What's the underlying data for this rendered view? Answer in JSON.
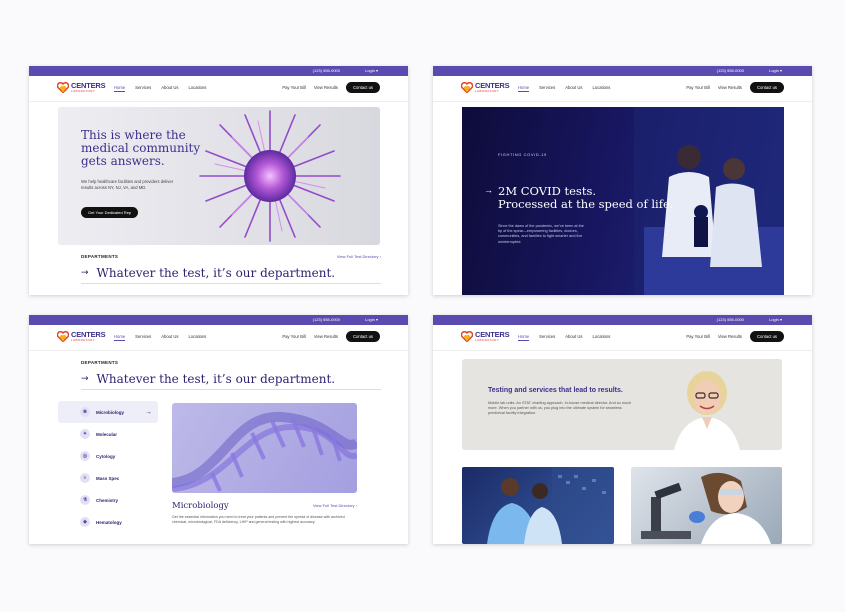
{
  "brand": {
    "name": "CENTERS",
    "sub": "LABORATORY"
  },
  "topbar": {
    "phone": "(123) 555-0000",
    "login": "Login ▾"
  },
  "nav": {
    "items": [
      "Home",
      "Services",
      "About Us",
      "Locations"
    ],
    "pay": "Pay Your Bill",
    "results": "View Results",
    "contact": "Contact us"
  },
  "screen1": {
    "hero_title": "This is where the medical community gets answers.",
    "hero_text": "We help healthcare facilities and providers deliver results across NY, NJ, VA, and MD.",
    "cta": "Get Your Dedicated Rep",
    "dept_label": "DEPARTMENTS",
    "dept_link": "View Full Test Directory ›",
    "dept_title": "Whatever the test, it’s our department."
  },
  "screen2": {
    "kicker": "FIGHTING COVID-19",
    "title_line1": "2M COVID tests.",
    "title_line2": "Processed at the speed of life.",
    "text": "Since the dawn of the pandemic, we’ve been at the tip of the spear—empowering facilities, doctors, communities, and families to fight smarter and live uninterrupted."
  },
  "screen3": {
    "dept_label": "DEPARTMENTS",
    "dept_title": "Whatever the test, it’s our department.",
    "departments": [
      {
        "label": "Microbiology",
        "icon": "microbe-icon",
        "glyph": "❀"
      },
      {
        "label": "Molecular",
        "icon": "molecule-icon",
        "glyph": "✦"
      },
      {
        "label": "Cytology",
        "icon": "cell-icon",
        "glyph": "◎"
      },
      {
        "label": "Mass Spec",
        "icon": "spectrum-icon",
        "glyph": "≡"
      },
      {
        "label": "Chemistry",
        "icon": "flask-icon",
        "glyph": "⚗"
      },
      {
        "label": "Hematology",
        "icon": "blood-drop-icon",
        "glyph": "◆"
      }
    ],
    "detail_title": "Microbiology",
    "detail_link": "View Full Test Directory ›",
    "detail_text": "Get the essential information you need to treat your patients and prevent the spread of disease with archived chemical, microbiological, FDA deficiency, LHIP and general testing with highest accuracy."
  },
  "screen4": {
    "title": "Testing and services that lead to results.",
    "text": "Mobile lab units. An STAT charting approach. In-house medical director. And so much more. When you partner with us, you plug into the ultimate system for seamless preclinical facility integration."
  },
  "colors": {
    "primary": "#5a4bb0",
    "dark": "#2f236f",
    "black": "#111111"
  }
}
